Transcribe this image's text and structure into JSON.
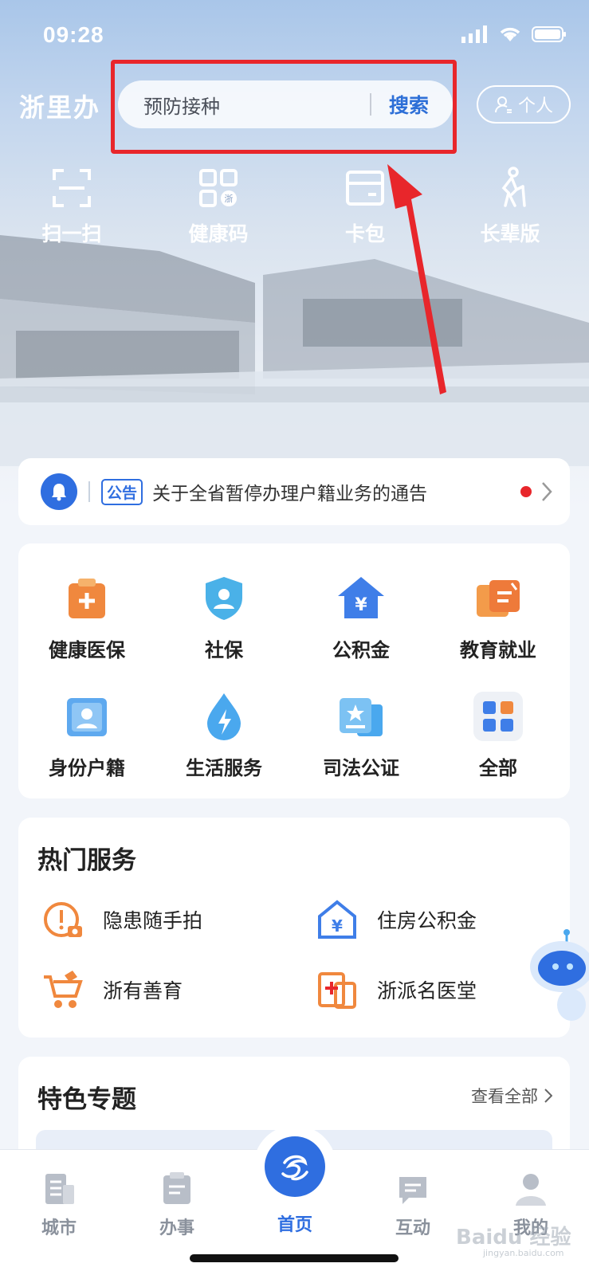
{
  "status_bar": {
    "time": "09:28"
  },
  "header": {
    "logo": "浙里办",
    "search_placeholder": "预防接种",
    "search_button": "搜索",
    "personal_button": "个人"
  },
  "quick_actions": [
    {
      "label": "扫一扫",
      "icon": "scan-icon"
    },
    {
      "label": "健康码",
      "icon": "health-code-icon"
    },
    {
      "label": "卡包",
      "icon": "card-wallet-icon"
    },
    {
      "label": "长辈版",
      "icon": "elder-mode-icon"
    }
  ],
  "notice": {
    "tag": "公告",
    "text": "关于全省暂停办理户籍业务的通告"
  },
  "services": [
    {
      "label": "健康医保",
      "icon": "medical-insurance-icon"
    },
    {
      "label": "社保",
      "icon": "social-security-icon"
    },
    {
      "label": "公积金",
      "icon": "housing-fund-icon"
    },
    {
      "label": "教育就业",
      "icon": "education-icon"
    },
    {
      "label": "身份户籍",
      "icon": "identity-icon"
    },
    {
      "label": "生活服务",
      "icon": "life-service-icon"
    },
    {
      "label": "司法公证",
      "icon": "notary-icon"
    },
    {
      "label": "全部",
      "icon": "all-apps-icon"
    }
  ],
  "hot_services": {
    "title": "热门服务",
    "items": [
      {
        "label": "隐患随手拍",
        "icon": "hazard-photo-icon"
      },
      {
        "label": "住房公积金",
        "icon": "housing-fund-house-icon"
      },
      {
        "label": "浙有善育",
        "icon": "stroller-icon"
      },
      {
        "label": "浙派名医堂",
        "icon": "clinic-icon"
      }
    ]
  },
  "featured": {
    "title": "特色专题",
    "view_all": "查看全部"
  },
  "tabbar": {
    "items": [
      {
        "label": "城市",
        "icon": "city-icon"
      },
      {
        "label": "办事",
        "icon": "tasks-icon"
      },
      {
        "label": "首页",
        "icon": "home-logo-icon"
      },
      {
        "label": "互动",
        "icon": "chat-icon"
      },
      {
        "label": "我的",
        "icon": "profile-icon"
      }
    ],
    "active": "首页"
  },
  "watermark": {
    "text": "Baidu 经验",
    "sub": "jingyan.baidu.com"
  },
  "colors": {
    "accent": "#2f6ee0",
    "highlight": "#e8262b"
  }
}
